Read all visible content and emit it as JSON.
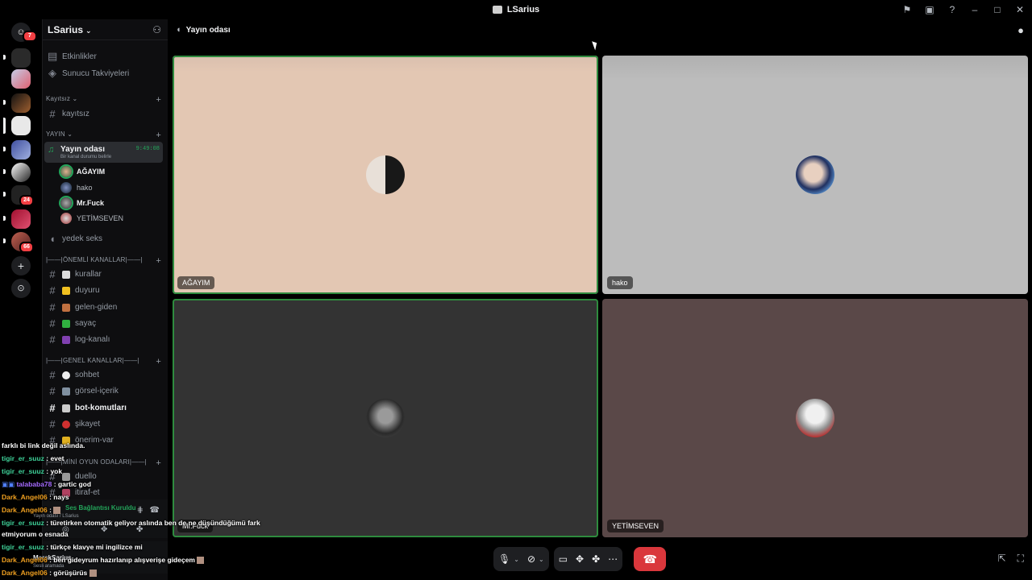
{
  "window": {
    "title": "LSarius"
  },
  "colors": {
    "accent_green": "#23a55a",
    "hangup": "#da373c",
    "badge": "#f23f43"
  },
  "rail": {
    "home_badge": "7",
    "badges": [
      "24",
      "66"
    ]
  },
  "sidebar": {
    "server_name": "LSarius",
    "top_items": [
      {
        "label": "Etkinlikler",
        "icon": "calendar-icon"
      },
      {
        "label": "Sunucu Takviyeleri",
        "icon": "boost-icon"
      }
    ],
    "cat_kayitsiz": "Kayıtsız",
    "ch_kayitsiz": "kayıtsız",
    "cat_yayin": "YAYIN",
    "voice_channel": {
      "name": "Yayın odası",
      "status": "Bir kanal durumu belirle",
      "time": "9:49:08"
    },
    "members": [
      "AĞAYIM",
      "hako",
      "Mr.Fuck",
      "YETİMSEVEN"
    ],
    "ch_yedek": "yedek seks",
    "cat_onemli": "|——|ÖNEMLİ KANALLAR|——|",
    "onemli_channels": [
      "kurallar",
      "duyuru",
      "gelen-giden",
      "sayaç",
      "log-kanalı"
    ],
    "cat_genel": "|——|GENEL KANALLAR|——|",
    "genel_channels": [
      "sohbet",
      "görsel-içerik",
      "bot-komutları",
      "şikayet",
      "önerim-var"
    ],
    "cat_oyun": "|——|MİNİ OYUN ODALARI|——|",
    "oyun_channels": [
      "duello",
      "itiraf-et"
    ],
    "voice_connected": "Ses Bağlantısı Kuruldu",
    "voice_connected_sub": "Yayın odası / LSarius",
    "user_name": "MarskSarius",
    "user_status": "Sesli aramada"
  },
  "main": {
    "header_title": "Yayın odası",
    "tiles": [
      {
        "name": "AĞAYIM",
        "bg": "#e3c7b3"
      },
      {
        "name": "hako",
        "bg": "#b9b9b9"
      },
      {
        "name": "Mr.Fuck",
        "bg": "#333333"
      },
      {
        "name": "YETİMSEVEN",
        "bg": "#5a4848"
      }
    ]
  },
  "chat": [
    {
      "user": "",
      "text": "farklı bi link değil aslında."
    },
    {
      "user": "tigir_er_suuz",
      "text": " : evet"
    },
    {
      "user": "tigir_er_suuz",
      "text": " : yok"
    },
    {
      "user": "talababa78",
      "text": " : gartic god"
    },
    {
      "user": "Dark_Angel06",
      "text": " : nays"
    },
    {
      "user": "Dark_Angel06",
      "text": " : "
    },
    {
      "user": "tigir_er_suuz",
      "text": " : türetirken otomatik geliyor aslında ben de ne düşündüğümü fark"
    },
    {
      "user": "",
      "text": "etmiyorum o esnada"
    },
    {
      "user": "tigir_er_suuz",
      "text": " : türkçe klavye mi ingilizce mi"
    },
    {
      "user": "Dark_Angel06",
      "text": " : ben gideyrum hazırlanıp alışverişe gideçem"
    },
    {
      "user": "Dark_Angel06",
      "text": " : görüşürüs"
    }
  ]
}
